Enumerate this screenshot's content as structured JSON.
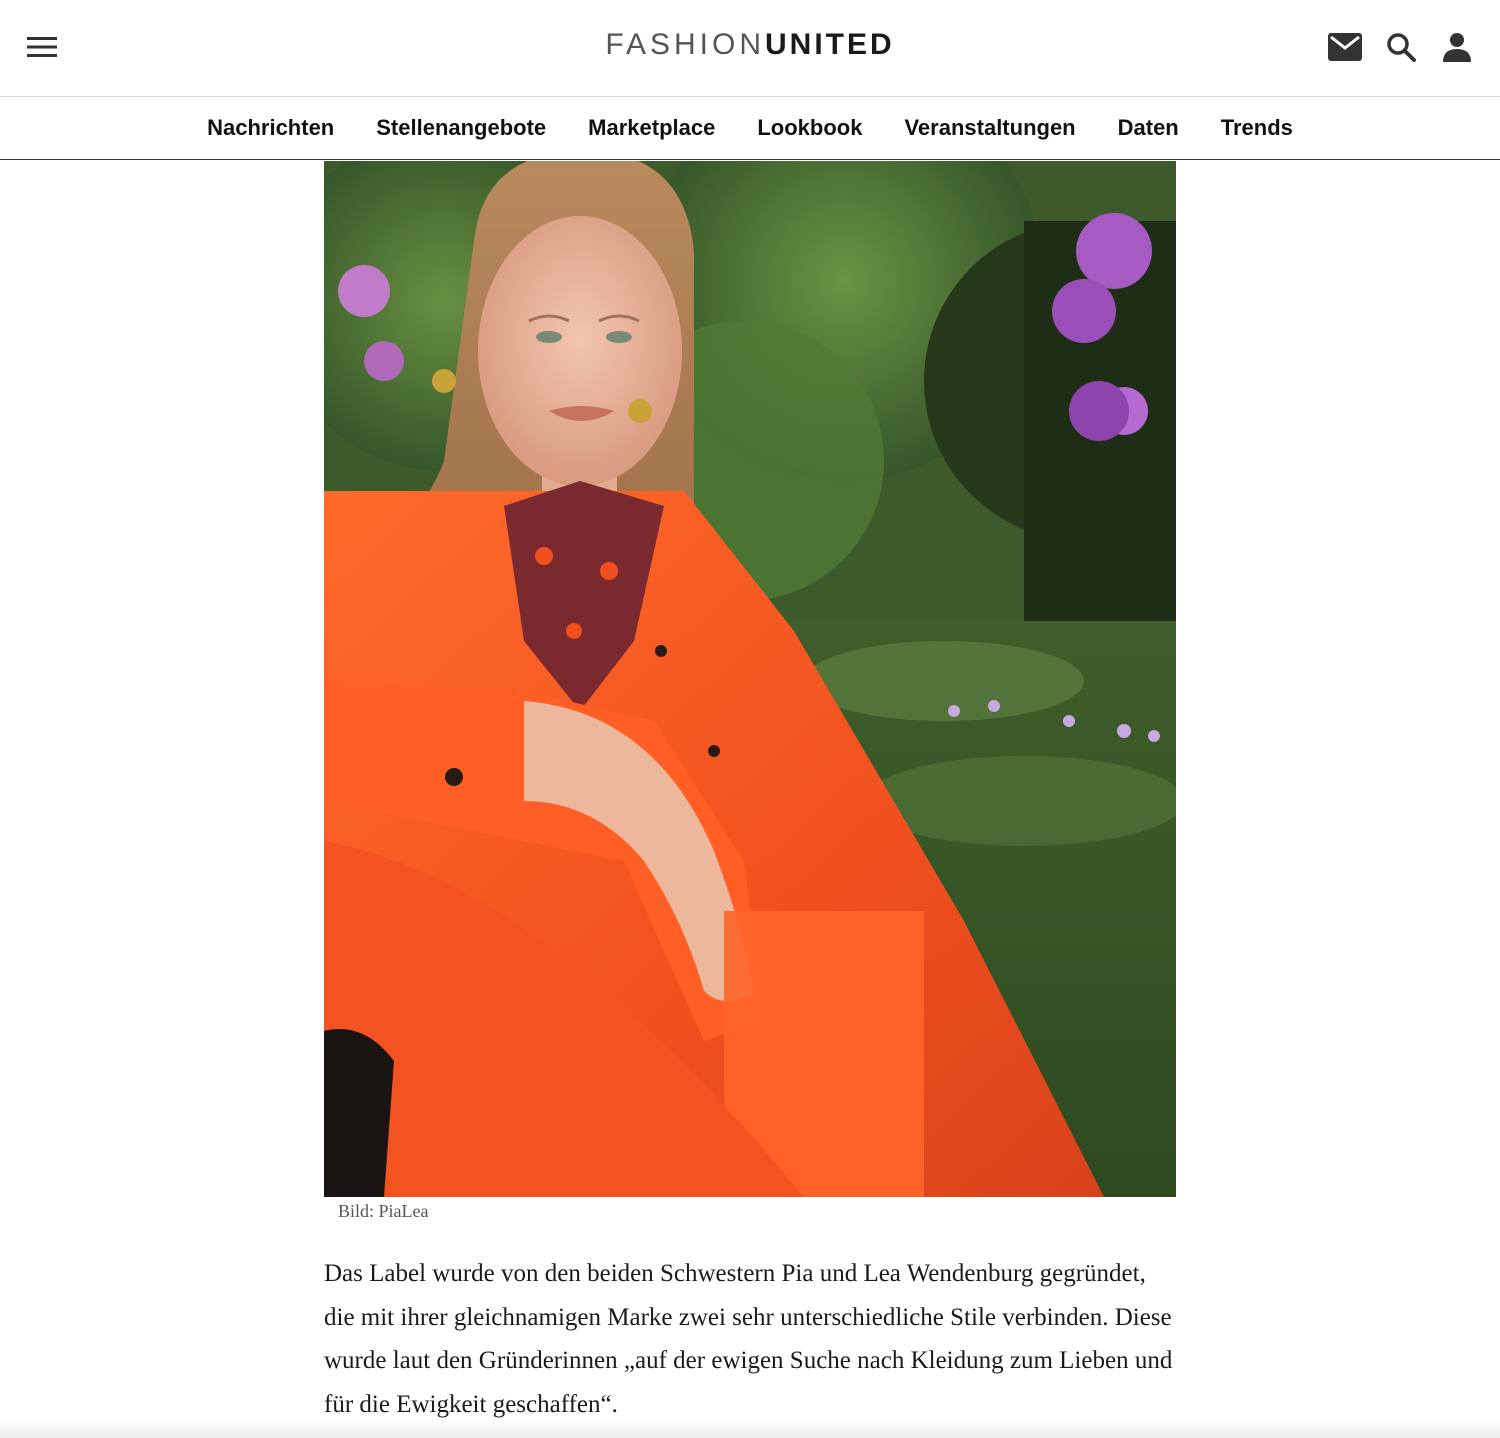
{
  "header": {
    "logo_light": "FASHION",
    "logo_bold": "UNITED",
    "icons": [
      "menu-icon",
      "mail-icon",
      "search-icon",
      "user-icon"
    ]
  },
  "nav": {
    "items": [
      {
        "label": "Nachrichten"
      },
      {
        "label": "Stellenangebote"
      },
      {
        "label": "Marketplace"
      },
      {
        "label": "Lookbook"
      },
      {
        "label": "Veranstaltungen"
      },
      {
        "label": "Daten"
      },
      {
        "label": "Trends"
      }
    ]
  },
  "article": {
    "image_caption": "Bild: PiaLea",
    "paragraph": "Das Label wurde von den beiden Schwestern Pia und Lea Wendenburg gegründet, die mit ihrer gleichnamigen Marke zwei sehr unterschiedliche Stile verbinden. Diese wurde laut den Gründerinnen „auf der ewigen Suche nach Kleidung zum Lieben und für die Ewigkeit geschaffen“."
  },
  "colors": {
    "accent_orange": "#f0501e",
    "text": "#111111"
  }
}
